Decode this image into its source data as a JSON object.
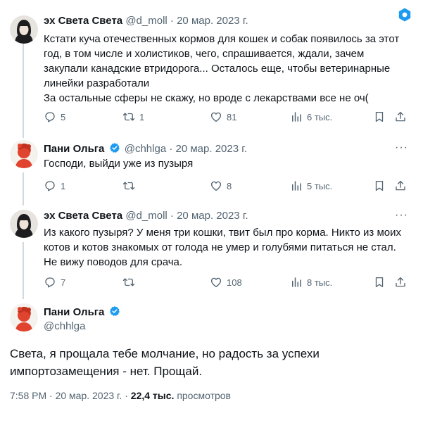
{
  "tweets": [
    {
      "name": "эх Света Света",
      "handle": "@d_moll",
      "date": "20 мар. 2023 г.",
      "lines": [
        "Кстати куча отечественных кормов для кошек и собак появилось за этот",
        "год, в том числе и холистиков, чего, спрашивается, ждали, зачем",
        "закупали канадские втридорога... Осталось еще, чтобы ветеринарные",
        "линейки разработали",
        "За остальные сферы не скажу, но вроде с лекарствами все не оч("
      ],
      "replies": "5",
      "retweets": "1",
      "likes": "81",
      "views": "6 тыс."
    },
    {
      "name": "Пани Ольга",
      "handle": "@chhlga",
      "date": "20 мар. 2023 г.",
      "lines": [
        "Господи, выйди уже из пузыря"
      ],
      "replies": "1",
      "retweets": "",
      "likes": "8",
      "views": "5 тыс."
    },
    {
      "name": "эх Света Света",
      "handle": "@d_moll",
      "date": "20 мар. 2023 г.",
      "lines": [
        "Из какого пузыря? У меня три кошки, твит был про корма. Никто из моих",
        "котов и котов знакомых от голода не умер и голубями питаться не стал.",
        "Не вижу поводов для срача."
      ],
      "replies": "7",
      "retweets": "",
      "likes": "108",
      "views": "8 тыс."
    }
  ],
  "main": {
    "name": "Пани Ольга",
    "handle": "@chhlga",
    "lines": [
      "Света, я прощала тебе молчание, но радость за успехи",
      "импортозамещения - нет. Прощай."
    ],
    "time": "7:58 PM · 20 мар. 2023 г. · ",
    "views_count": "22,4 тыс.",
    "views_label": "просмотров"
  },
  "separator": " · ",
  "more_glyph": "···",
  "colors": {
    "verified": "#1d9bf0",
    "secondary": "#536471",
    "thread": "#cfd9de"
  },
  "icons": [
    "settings-hex-icon",
    "reply-icon",
    "retweet-icon",
    "like-icon",
    "views-icon",
    "bookmark-icon",
    "share-icon",
    "verified-icon"
  ]
}
